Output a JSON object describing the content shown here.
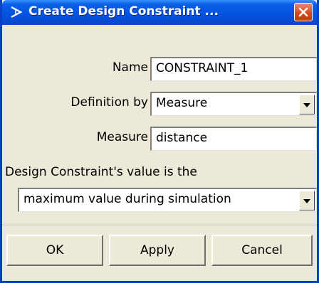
{
  "window": {
    "title": "Create Design Constraint ...",
    "title_icon": "x-arrow-icon",
    "close_icon": "close-icon"
  },
  "form": {
    "name_label": "Name",
    "name_value": "CONSTRAINT_1",
    "definition_label": "Definition by",
    "definition_value": "Measure",
    "measure_label": "Measure",
    "measure_value": "distance",
    "value_prompt": "Design Constraint's value is the",
    "value_selection": "maximum value during simulation"
  },
  "buttons": {
    "ok": "OK",
    "apply": "Apply",
    "cancel": "Cancel"
  },
  "colors": {
    "titlebar": "#0553e2",
    "close_button": "#d7461c",
    "dialog_bg": "#ece9d8"
  }
}
